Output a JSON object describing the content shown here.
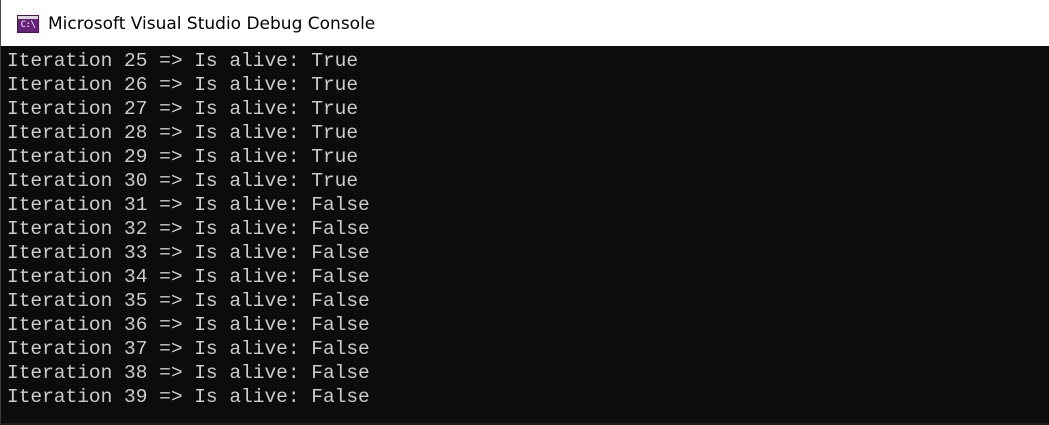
{
  "window": {
    "title": "Microsoft Visual Studio Debug Console",
    "icon": "console-app-icon",
    "icon_text": "C:\\"
  },
  "console": {
    "lines": [
      "Iteration 25 => Is alive: True",
      "Iteration 26 => Is alive: True",
      "Iteration 27 => Is alive: True",
      "Iteration 28 => Is alive: True",
      "Iteration 29 => Is alive: True",
      "Iteration 30 => Is alive: True",
      "Iteration 31 => Is alive: False",
      "Iteration 32 => Is alive: False",
      "Iteration 33 => Is alive: False",
      "Iteration 34 => Is alive: False",
      "Iteration 35 => Is alive: False",
      "Iteration 36 => Is alive: False",
      "Iteration 37 => Is alive: False",
      "Iteration 38 => Is alive: False",
      "Iteration 39 => Is alive: False"
    ]
  },
  "colors": {
    "console_background": "#0c0c0c",
    "console_text": "#cccccc",
    "titlebar_background": "#ffffff",
    "icon_accent": "#68217a"
  }
}
